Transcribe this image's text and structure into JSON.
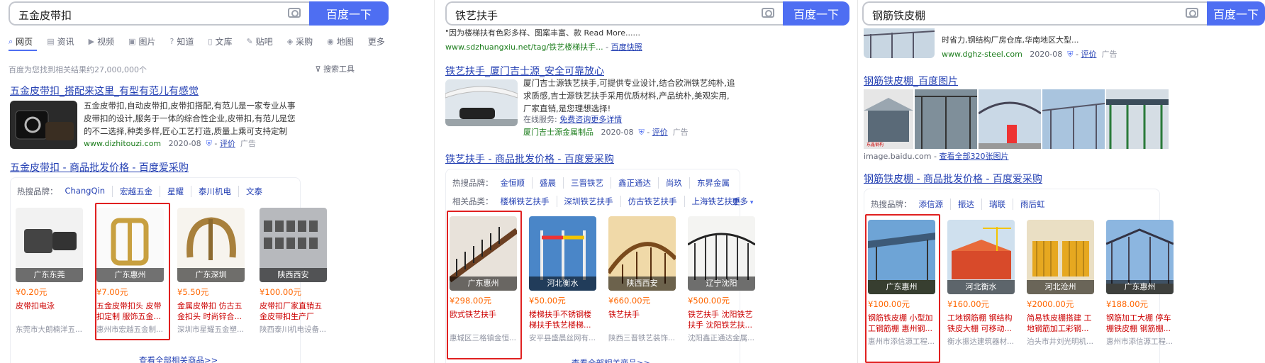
{
  "panel1": {
    "query": "五金皮带扣",
    "search_button": "百度一下",
    "tabs": [
      "网页",
      "资讯",
      "视频",
      "图片",
      "知道",
      "文库",
      "贴吧",
      "采购",
      "地图",
      "更多"
    ],
    "result_count": "百度为您找到相关结果约27,000,000个",
    "search_tools": "搜索工具",
    "result1": {
      "title": "五金皮带扣_搭配来这里_有型有范儿有感觉",
      "snippet": "五金皮带扣,自动皮带扣,皮带扣搭配,有范儿是一家专业从事皮带扣的设计,服务于一体的综合性企业,皮带扣,有范儿是您的不二选择,种类多样,匠心工艺打造,质量上乘可支持定制",
      "url": "www.dizhitouzi.com",
      "date": "2020-08",
      "eval": "评价",
      "ad": "广告"
    },
    "result2": {
      "title": "五金皮带扣 - 商品批发价格 - 百度爱采购",
      "hot_label": "热搜品牌：",
      "brands": [
        "ChangQin",
        "宏越五金",
        "星耀",
        "泰川机电",
        "文泰"
      ],
      "products": [
        {
          "loc": "广东东莞",
          "price": "¥0.20元",
          "name": "皮带扣电泳",
          "seller": "东莞市大朗楠洋五..."
        },
        {
          "loc": "广东惠州",
          "price": "¥7.00元",
          "name": "五金皮带扣头 皮带扣定制 服饰五金...",
          "seller": "惠州市宏越五金制..."
        },
        {
          "loc": "广东深圳",
          "price": "¥5.50元",
          "name": "金属皮带扣 仿古五金扣头 时尚锌合...",
          "seller": "深圳市星耀五金塑..."
        },
        {
          "loc": "陕西西安",
          "price": "¥100.00元",
          "name": "皮带扣厂家直销五金皮带扣生产厂家...",
          "seller": "陕西泰川机电设备..."
        }
      ],
      "see_all": "查看全部相关商品>>"
    }
  },
  "panel2": {
    "query": "铁艺扶手",
    "search_button": "百度一下",
    "top_snippet": "\"因为楼梯扶有色彩多样、图案丰富、款 Read More......",
    "top_url": "www.sdzhuangxiu.net/tag/铁艺楼梯扶手...",
    "top_snap": "百度快照",
    "result1": {
      "title": "铁艺扶手_厦门吉士源_安全可靠放心",
      "snippet": "厦门吉士源铁艺扶手,可提供专业设计,结合欧洲铁艺纯朴,追求质感,吉士源铁艺扶手采用优质材料,产品统朴,美观实用,厂家直销,是您理想选择!",
      "service": "在线服务:",
      "service_link": "免费咨询更多详情",
      "company": "厦门吉士源金属制品",
      "date": "2020-08",
      "eval": "评价",
      "ad": "广告"
    },
    "result2": {
      "title": "铁艺扶手 - 商品批发价格 - 百度爱采购",
      "hot_label": "热搜品牌：",
      "brands": [
        "金恒顺",
        "盛晨",
        "三晋铁艺",
        "鑫正通达",
        "尚玖",
        "东昇金属"
      ],
      "rel_label": "相关品类：",
      "rels": [
        "楼梯铁艺扶手",
        "深圳铁艺扶手",
        "仿古铁艺扶手",
        "上海铁艺扶手"
      ],
      "rel_more": "更多",
      "products": [
        {
          "loc": "广东惠州",
          "price": "¥298.00元",
          "name": "欧式铁艺扶手",
          "seller": "惠城区三格镇金恒..."
        },
        {
          "loc": "河北衡水",
          "price": "¥50.00元",
          "name": "楼梯扶手不锈钢楼梯扶手铁艺楼梯...",
          "seller": "安平县盛晨丝网有..."
        },
        {
          "loc": "陕西西安",
          "price": "¥660.00元",
          "name": "铁艺扶手",
          "seller": "陕西三晋铁艺装饰..."
        },
        {
          "loc": "辽宁沈阳",
          "price": "¥500.00元",
          "name": "铁艺扶手 沈阳铁艺扶手 沈阳铁艺扶...",
          "seller": "沈阳鑫正通达金属..."
        }
      ],
      "see_all": "查看全部相关商品>>"
    }
  },
  "panel3": {
    "query": "钢筋铁皮棚",
    "search_button": "百度一下",
    "top_snippet": "时省力,钢结构厂房仓库,华南地区大型...",
    "top_url": "www.dghz-steel.com",
    "top_date": "2020-08",
    "top_eval": "评价",
    "top_ad": "广告",
    "img_result": {
      "title": "钢筋铁皮棚_百度图片",
      "source": "image.baidu.com",
      "more": "查看全部320张图片"
    },
    "result2": {
      "title": "钢筋铁皮棚 - 商品批发价格 - 百度爱采购",
      "hot_label": "热搜品牌：",
      "brands": [
        "添信源",
        "振达",
        "瑞联",
        "雨后虹"
      ],
      "products": [
        {
          "loc": "广东惠州",
          "price": "¥100.00元",
          "name": "钢筋铁皮棚 小型加工钢筋棚 惠州钢...",
          "seller": "惠州市添信源工程..."
        },
        {
          "loc": "河北衡水",
          "price": "¥160.00元",
          "name": "工地钢筋棚 钢结构铁皮大棚 可移动...",
          "seller": "衡水振达建筑器材..."
        },
        {
          "loc": "河北沧州",
          "price": "¥2000.00元",
          "name": "简易铁皮棚搭建 工地钢筋加工彩钢...",
          "seller": "泊头市井刘光明机..."
        },
        {
          "loc": "广东惠州",
          "price": "¥188.00元",
          "name": "钢筋加工大棚 停车棚铁皮棚 钢筋棚...",
          "seller": "惠州市添信源工程..."
        }
      ]
    }
  }
}
